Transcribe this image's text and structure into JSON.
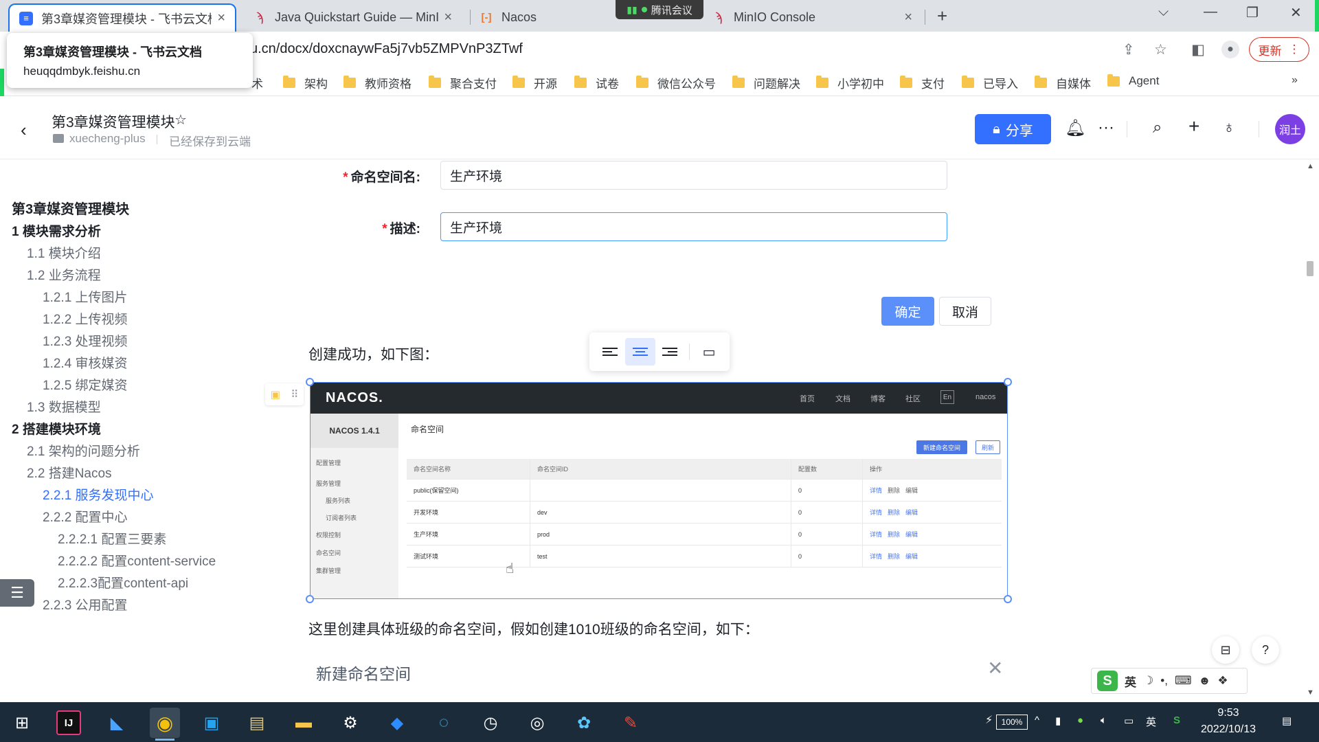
{
  "browser": {
    "tabs": [
      {
        "title": "第3章媒资管理模块 - 飞书云文档",
        "active": true
      },
      {
        "title": "Java Quickstart Guide — MinIO",
        "active": false
      },
      {
        "title": "Nacos",
        "active": false
      },
      {
        "title": "MinIO Console",
        "active": false
      }
    ],
    "meeting_overlay": "腾讯会议",
    "url": "u.cn/docx/doxcnaywFa5j7vb5ZMPVnP3ZTwf",
    "update_label": "更新",
    "tooltip": {
      "title": "第3章媒资管理模块 - 飞书云文档",
      "domain": "heuqqdmbyk.feishu.cn"
    },
    "bookmark_partial": "术",
    "bookmarks": [
      "架构",
      "教师资格",
      "聚合支付",
      "开源",
      "试卷",
      "微信公众号",
      "问题解决",
      "小学初中",
      "支付",
      "已导入",
      "自媒体",
      "Agent"
    ]
  },
  "doc_header": {
    "title": "第3章媒资管理模块",
    "folder": "xuecheng-plus",
    "status": "已经保存到云端",
    "share_label": "分享",
    "avatar_text": "润土"
  },
  "toc": [
    {
      "label": "第3章媒资管理模块",
      "level": 0
    },
    {
      "label": "1 模块需求分析",
      "level": 1
    },
    {
      "label": "1.1 模块介绍",
      "level": 2
    },
    {
      "label": "1.2 业务流程",
      "level": 2
    },
    {
      "label": "1.2.1 上传图片",
      "level": 3
    },
    {
      "label": "1.2.2 上传视频",
      "level": 3
    },
    {
      "label": "1.2.3 处理视频",
      "level": 3
    },
    {
      "label": "1.2.4 审核媒资",
      "level": 3
    },
    {
      "label": "1.2.5 绑定媒资",
      "level": 3
    },
    {
      "label": "1.3 数据模型",
      "level": 2
    },
    {
      "label": "2 搭建模块环境",
      "level": 1
    },
    {
      "label": "2.1 架构的问题分析",
      "level": 2
    },
    {
      "label": "2.2 搭建Nacos",
      "level": 2
    },
    {
      "label": "2.2.1 服务发现中心",
      "level": 3,
      "active": true
    },
    {
      "label": "2.2.2 配置中心",
      "level": 3
    },
    {
      "label": "2.2.2.1 配置三要素",
      "level": 4
    },
    {
      "label": "2.2.2.2 配置content-service",
      "level": 4
    },
    {
      "label": "2.2.2.3配置content-api",
      "level": 4
    },
    {
      "label": "2.2.3 公用配置",
      "level": 3
    }
  ],
  "form": {
    "ns_name_label": "命名空间名:",
    "ns_name_value": "生产环境",
    "desc_label": "描述:",
    "desc_value": "生产环境",
    "required_mark": "*",
    "confirm_label": "确定",
    "cancel_label": "取消"
  },
  "doc_text": {
    "created_para": "创建成功，如下图：",
    "class_para": "这里创建具体班级的命名空间，假如创建1010班级的命名空间，如下：",
    "new_ns_title": "新建命名空间"
  },
  "nacos": {
    "logo": "NACOS.",
    "nav": [
      "首页",
      "文档",
      "博客",
      "社区",
      "En",
      "nacos"
    ],
    "version": "NACOS 1.4.1",
    "menu": [
      "配置管理",
      "服务管理",
      "服务列表",
      "订阅者列表",
      "权限控制",
      "命名空间",
      "集群管理"
    ],
    "breadcrumb": "命名空间",
    "new_btn": "新建命名空间",
    "refresh_btn": "刷新",
    "table_headers": [
      "命名空间名称",
      "命名空间ID",
      "配置数",
      "操作"
    ],
    "rows": [
      {
        "name": "public(保留空间)",
        "id": "",
        "count": "0",
        "ops": [
          "详情",
          "删除",
          "编辑"
        ]
      },
      {
        "name": "开发环境",
        "id": "dev",
        "count": "0",
        "ops": [
          "详情",
          "删除",
          "编辑"
        ]
      },
      {
        "name": "生产环境",
        "id": "prod",
        "count": "0",
        "ops": [
          "详情",
          "删除",
          "编辑"
        ]
      },
      {
        "name": "测试环境",
        "id": "test",
        "count": "0",
        "ops": [
          "详情",
          "删除",
          "编辑"
        ]
      }
    ]
  },
  "ime": {
    "mode": "英"
  },
  "taskbar": {
    "battery": "100%",
    "ime_indicator": "英",
    "time": "9:53",
    "date": "2022/10/13"
  },
  "colors": {
    "accent": "#3370ff",
    "active_toc": "#3370ff",
    "confirm_btn": "#5b8ff9"
  }
}
